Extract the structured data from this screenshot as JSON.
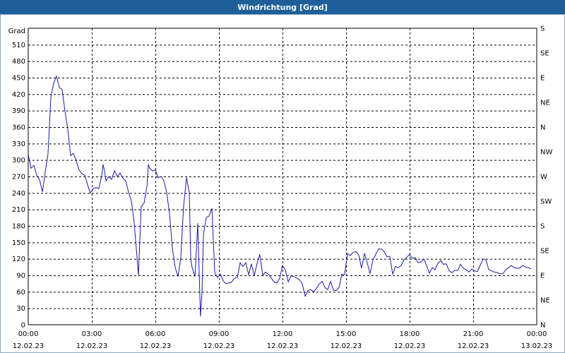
{
  "window": {
    "title": "Windrichtung [Grad]"
  },
  "colors": {
    "title_bg": "#1f5f99",
    "line": "#1a1aa6",
    "grid": "#000000"
  },
  "chart_data": {
    "type": "line",
    "title": "Windrichtung [Grad]",
    "ylabel": "Grad",
    "ylim": [
      0,
      540
    ],
    "xlim_hours": [
      0,
      24
    ],
    "y_ticks": [
      0,
      30,
      60,
      90,
      120,
      150,
      180,
      210,
      240,
      270,
      300,
      330,
      360,
      390,
      420,
      450,
      480,
      510
    ],
    "right_ticks": [
      {
        "value": 0,
        "label": "N"
      },
      {
        "value": 45,
        "label": "NE"
      },
      {
        "value": 90,
        "label": "E"
      },
      {
        "value": 135,
        "label": "SE"
      },
      {
        "value": 180,
        "label": "S"
      },
      {
        "value": 225,
        "label": "SW"
      },
      {
        "value": 270,
        "label": "W"
      },
      {
        "value": 315,
        "label": "NW"
      },
      {
        "value": 360,
        "label": "N"
      },
      {
        "value": 405,
        "label": "NE"
      },
      {
        "value": 450,
        "label": "E"
      },
      {
        "value": 495,
        "label": "SE"
      },
      {
        "value": 540,
        "label": "S"
      }
    ],
    "x_ticks": [
      {
        "hour": 0,
        "time": "00:00",
        "date": "12.02.23"
      },
      {
        "hour": 3,
        "time": "03:00",
        "date": "12.02.23"
      },
      {
        "hour": 6,
        "time": "06:00",
        "date": "12.02.23"
      },
      {
        "hour": 9,
        "time": "09:00",
        "date": "12.02.23"
      },
      {
        "hour": 12,
        "time": "12:00",
        "date": "12.02.23"
      },
      {
        "hour": 15,
        "time": "15:00",
        "date": "12.02.23"
      },
      {
        "hour": 18,
        "time": "18:00",
        "date": "12.02.23"
      },
      {
        "hour": 21,
        "time": "21:00",
        "date": "12.02.23"
      },
      {
        "hour": 24,
        "time": "00:00",
        "date": "13.02.23"
      }
    ],
    "grid": true,
    "series": [
      {
        "points": [
          [
            0.0,
            310
          ],
          [
            0.13,
            285
          ],
          [
            0.27,
            290
          ],
          [
            0.4,
            272
          ],
          [
            0.53,
            265
          ],
          [
            0.67,
            242
          ],
          [
            0.8,
            278
          ],
          [
            0.93,
            310
          ],
          [
            1.07,
            415
          ],
          [
            1.2,
            440
          ],
          [
            1.33,
            453
          ],
          [
            1.47,
            432
          ],
          [
            1.6,
            428
          ],
          [
            1.73,
            390
          ],
          [
            1.87,
            355
          ],
          [
            2.0,
            308
          ],
          [
            2.13,
            312
          ],
          [
            2.27,
            298
          ],
          [
            2.4,
            282
          ],
          [
            2.53,
            275
          ],
          [
            2.67,
            272
          ],
          [
            2.8,
            255
          ],
          [
            2.93,
            240
          ],
          [
            3.07,
            248
          ],
          [
            3.2,
            250
          ],
          [
            3.33,
            248
          ],
          [
            3.47,
            272
          ],
          [
            3.53,
            292
          ],
          [
            3.6,
            280
          ],
          [
            3.67,
            262
          ],
          [
            3.8,
            270
          ],
          [
            3.93,
            265
          ],
          [
            4.07,
            280
          ],
          [
            4.2,
            270
          ],
          [
            4.33,
            276
          ],
          [
            4.47,
            267
          ],
          [
            4.6,
            262
          ],
          [
            4.73,
            242
          ],
          [
            4.87,
            225
          ],
          [
            5.0,
            185
          ],
          [
            5.13,
            125
          ],
          [
            5.2,
            90
          ],
          [
            5.33,
            215
          ],
          [
            5.47,
            222
          ],
          [
            5.6,
            252
          ],
          [
            5.67,
            292
          ],
          [
            5.73,
            285
          ],
          [
            5.87,
            280
          ],
          [
            6.0,
            282
          ],
          [
            6.13,
            268
          ],
          [
            6.27,
            270
          ],
          [
            6.4,
            262
          ],
          [
            6.53,
            242
          ],
          [
            6.67,
            202
          ],
          [
            6.8,
            140
          ],
          [
            6.93,
            105
          ],
          [
            7.07,
            88
          ],
          [
            7.2,
            122
          ],
          [
            7.33,
            215
          ],
          [
            7.47,
            268
          ],
          [
            7.53,
            255
          ],
          [
            7.6,
            240
          ],
          [
            7.67,
            120
          ],
          [
            7.73,
            105
          ],
          [
            7.87,
            88
          ],
          [
            8.0,
            185
          ],
          [
            8.07,
            90
          ],
          [
            8.13,
            15
          ],
          [
            8.2,
            60
          ],
          [
            8.27,
            165
          ],
          [
            8.4,
            195
          ],
          [
            8.53,
            198
          ],
          [
            8.67,
            212
          ],
          [
            8.8,
            95
          ],
          [
            8.93,
            86
          ],
          [
            9.07,
            92
          ],
          [
            9.2,
            80
          ],
          [
            9.33,
            75
          ],
          [
            9.47,
            76
          ],
          [
            9.6,
            78
          ],
          [
            9.73,
            85
          ],
          [
            9.87,
            86
          ],
          [
            10.0,
            113
          ],
          [
            10.13,
            106
          ],
          [
            10.27,
            113
          ],
          [
            10.4,
            91
          ],
          [
            10.53,
            111
          ],
          [
            10.67,
            90
          ],
          [
            10.8,
            112
          ],
          [
            10.93,
            128
          ],
          [
            11.07,
            90
          ],
          [
            11.2,
            96
          ],
          [
            11.33,
            92
          ],
          [
            11.47,
            85
          ],
          [
            11.6,
            78
          ],
          [
            11.73,
            76
          ],
          [
            11.87,
            85
          ],
          [
            12.0,
            108
          ],
          [
            12.13,
            100
          ],
          [
            12.27,
            78
          ],
          [
            12.4,
            89
          ],
          [
            12.53,
            88
          ],
          [
            12.67,
            85
          ],
          [
            12.8,
            82
          ],
          [
            12.93,
            75
          ],
          [
            13.07,
            52
          ],
          [
            13.2,
            62
          ],
          [
            13.33,
            64
          ],
          [
            13.47,
            60
          ],
          [
            13.6,
            66
          ],
          [
            13.73,
            74
          ],
          [
            13.87,
            79
          ],
          [
            14.0,
            68
          ],
          [
            14.13,
            64
          ],
          [
            14.27,
            79
          ],
          [
            14.4,
            63
          ],
          [
            14.53,
            62
          ],
          [
            14.67,
            68
          ],
          [
            14.8,
            92
          ],
          [
            14.93,
            91
          ],
          [
            15.07,
            130
          ],
          [
            15.2,
            126
          ],
          [
            15.33,
            132
          ],
          [
            15.47,
            133
          ],
          [
            15.6,
            127
          ],
          [
            15.73,
            103
          ],
          [
            15.87,
            130
          ],
          [
            16.0,
            113
          ],
          [
            16.13,
            93
          ],
          [
            16.27,
            118
          ],
          [
            16.4,
            128
          ],
          [
            16.53,
            138
          ],
          [
            16.67,
            138
          ],
          [
            16.8,
            133
          ],
          [
            16.93,
            124
          ],
          [
            17.07,
            124
          ],
          [
            17.2,
            92
          ],
          [
            17.33,
            106
          ],
          [
            17.47,
            104
          ],
          [
            17.6,
            108
          ],
          [
            17.73,
            118
          ],
          [
            17.87,
            123
          ],
          [
            18.0,
            128
          ],
          [
            18.13,
            121
          ],
          [
            18.27,
            122
          ],
          [
            18.4,
            113
          ],
          [
            18.53,
            114
          ],
          [
            18.67,
            120
          ],
          [
            18.8,
            108
          ],
          [
            18.93,
            94
          ],
          [
            19.07,
            104
          ],
          [
            19.2,
            100
          ],
          [
            19.33,
            112
          ],
          [
            19.47,
            117
          ],
          [
            19.6,
            110
          ],
          [
            19.73,
            111
          ],
          [
            19.87,
            98
          ],
          [
            20.0,
            95
          ],
          [
            20.13,
            99
          ],
          [
            20.27,
            99
          ],
          [
            20.4,
            110
          ],
          [
            20.53,
            103
          ],
          [
            20.67,
            100
          ],
          [
            20.8,
            96
          ],
          [
            20.93,
            101
          ],
          [
            21.07,
            98
          ],
          [
            21.2,
            97
          ],
          [
            21.33,
            108
          ],
          [
            21.47,
            120
          ],
          [
            21.6,
            118
          ],
          [
            21.73,
            101
          ],
          [
            21.87,
            98
          ],
          [
            22.0,
            96
          ],
          [
            22.13,
            95
          ],
          [
            22.27,
            93
          ],
          [
            22.4,
            93
          ],
          [
            22.53,
            100
          ],
          [
            22.67,
            104
          ],
          [
            22.8,
            108
          ],
          [
            22.93,
            104
          ],
          [
            23.07,
            103
          ],
          [
            23.2,
            103
          ],
          [
            23.33,
            108
          ],
          [
            23.47,
            105
          ],
          [
            23.6,
            104
          ],
          [
            23.73,
            102
          ]
        ]
      }
    ]
  }
}
